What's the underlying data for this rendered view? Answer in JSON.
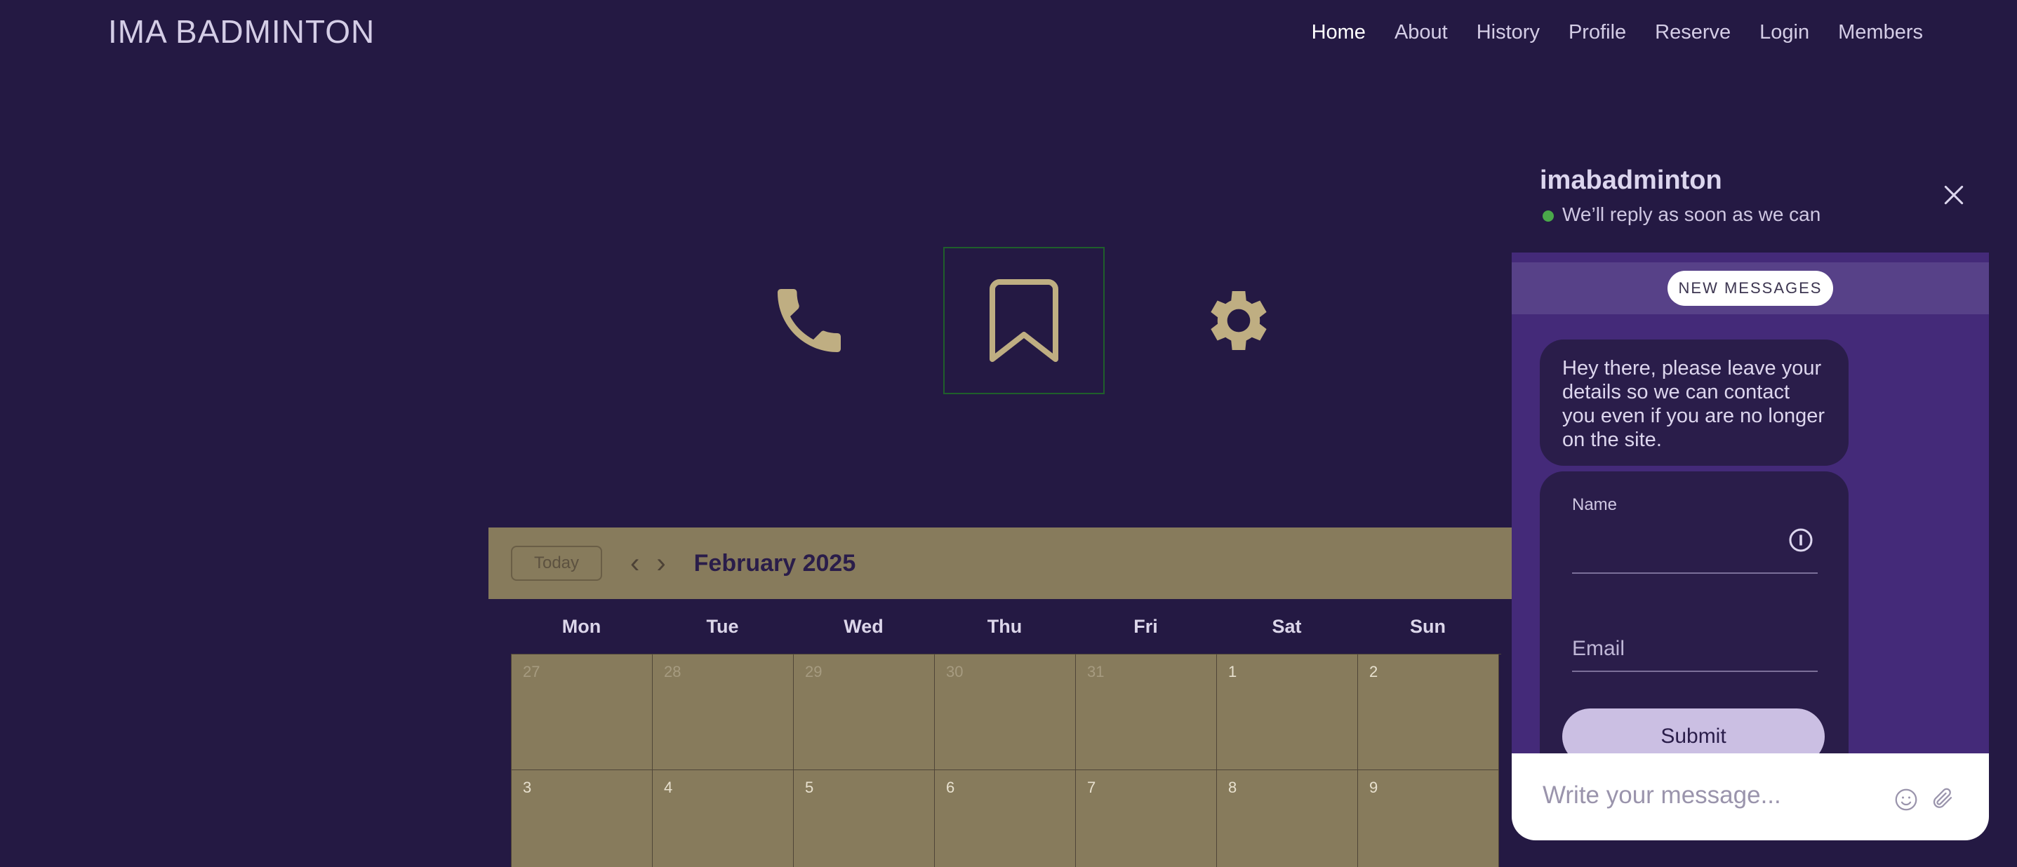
{
  "brand": "IMA BADMINTON",
  "nav": [
    "Home",
    "About",
    "History",
    "Profile",
    "Reserve",
    "Login",
    "Members"
  ],
  "icons": [
    "phone-icon",
    "bookmark-icon",
    "gear-icon"
  ],
  "calendar": {
    "today_label": "Today",
    "month": "February 2025",
    "weekdays": [
      "Mon",
      "Tue",
      "Wed",
      "Thu",
      "Fri",
      "Sat",
      "Sun"
    ],
    "weeks": [
      [
        {
          "d": "27",
          "muted": true
        },
        {
          "d": "28",
          "muted": true
        },
        {
          "d": "29",
          "muted": true
        },
        {
          "d": "30",
          "muted": true
        },
        {
          "d": "31",
          "muted": true
        },
        {
          "d": "1",
          "muted": false
        },
        {
          "d": "2",
          "muted": false
        }
      ],
      [
        {
          "d": "3",
          "muted": false
        },
        {
          "d": "4",
          "muted": false
        },
        {
          "d": "5",
          "muted": false
        },
        {
          "d": "6",
          "muted": false
        },
        {
          "d": "7",
          "muted": false
        },
        {
          "d": "8",
          "muted": false
        },
        {
          "d": "9",
          "muted": false
        }
      ]
    ]
  },
  "chat": {
    "name": "imabadminton",
    "status": "We’ll reply as soon as we can",
    "new_messages": "NEW MESSAGES",
    "message": "Hey there, please leave your details so we can contact you even if you are no longer on the site.",
    "name_label": "Name",
    "email_placeholder": "Email",
    "submit_label": "Submit",
    "input_placeholder": "Write your message..."
  },
  "colors": {
    "background": "#241943",
    "gold": "#bfae82",
    "calendar": "#877b5c",
    "chat_purple": "#442a79"
  }
}
